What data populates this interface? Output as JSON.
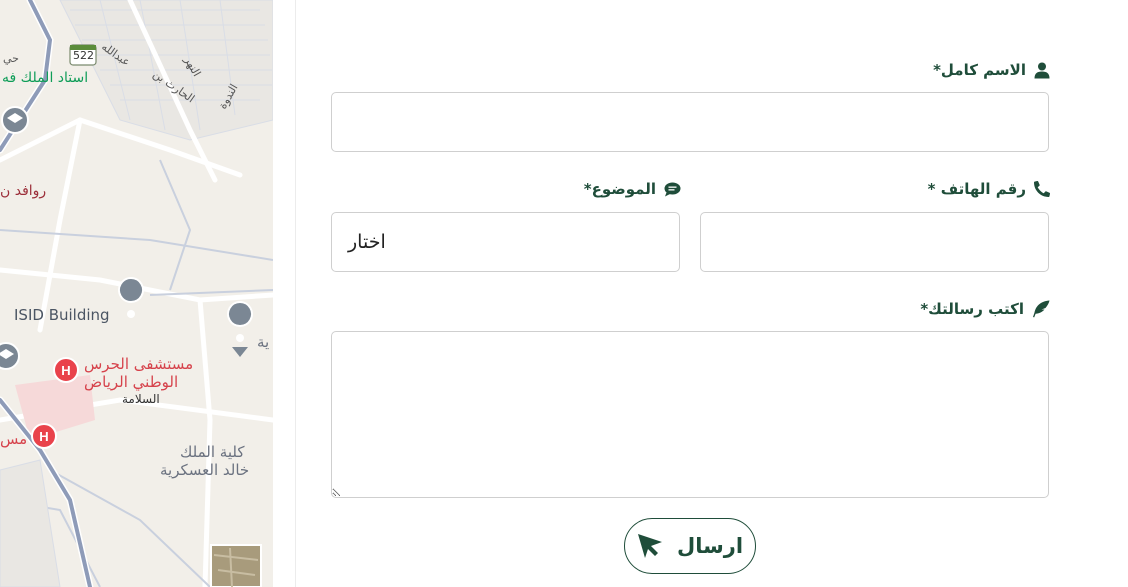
{
  "map": {
    "labels": {
      "stadium": "استاد الملك فه",
      "rawafed": "روافد ن",
      "isid": "ISID Building",
      "hospital_line1": "مستشفى الحرس",
      "hospital_line2": "الوطني الرياض",
      "salama": "السلامة",
      "college_line1": "كلية الملك",
      "college_line2": "خالد العسكرية",
      "route": "522",
      "street_abdullah": "عبدالله",
      "street_harith": "الحارث بن",
      "street_nahr": "النهر",
      "street_nadwa": "الندوة",
      "hay": "حي",
      "left_ms": "مس",
      "right_ya": "ية"
    },
    "colors": {
      "base": "#f2efe9",
      "road": "#9aa6bf",
      "hospital": "#e9424b",
      "poi": "#7b8794",
      "green": "#0f9d58"
    }
  },
  "form": {
    "full_name": {
      "label": "الاسم كامل*",
      "value": ""
    },
    "phone": {
      "label": "رقم الهاتف *",
      "value": ""
    },
    "subject": {
      "label": "الموضوع*",
      "selected": "اختار"
    },
    "message": {
      "label": "اكتب رسالتك*",
      "value": ""
    },
    "send_label": "ارسال"
  },
  "colors": {
    "brand": "#1f4d3a",
    "border": "#cfcfcf"
  }
}
